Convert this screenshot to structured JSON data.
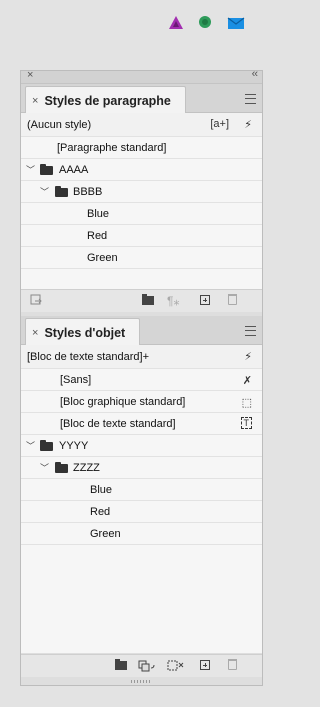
{
  "top_icons": [
    "triangle-icon",
    "circle-icon",
    "mail-icon"
  ],
  "panel1": {
    "tab_label": "Styles de paragraphe",
    "current_style": "(Aucun style)",
    "current_icons": [
      "[a+]",
      "⚡"
    ],
    "rows": [
      {
        "label": "[Paragraphe standard]"
      },
      {
        "label": "AAAA"
      },
      {
        "label": "BBBB"
      },
      {
        "label": "Blue"
      },
      {
        "label": "Red"
      },
      {
        "label": "Green"
      }
    ],
    "footer_glyph": "¶⁎"
  },
  "panel2": {
    "tab_label": "Styles d'objet",
    "current_style": "[Bloc de texte standard]+",
    "current_icon": "⚡",
    "rows": [
      {
        "label": "[Sans]",
        "icon": "✗"
      },
      {
        "label": "[Bloc graphique standard]",
        "icon": "⬚"
      },
      {
        "label": "[Bloc de texte standard]",
        "icon": "T"
      },
      {
        "label": "YYYY"
      },
      {
        "label": "ZZZZ"
      },
      {
        "label": "Blue"
      },
      {
        "label": "Red"
      },
      {
        "label": "Green"
      }
    ]
  }
}
